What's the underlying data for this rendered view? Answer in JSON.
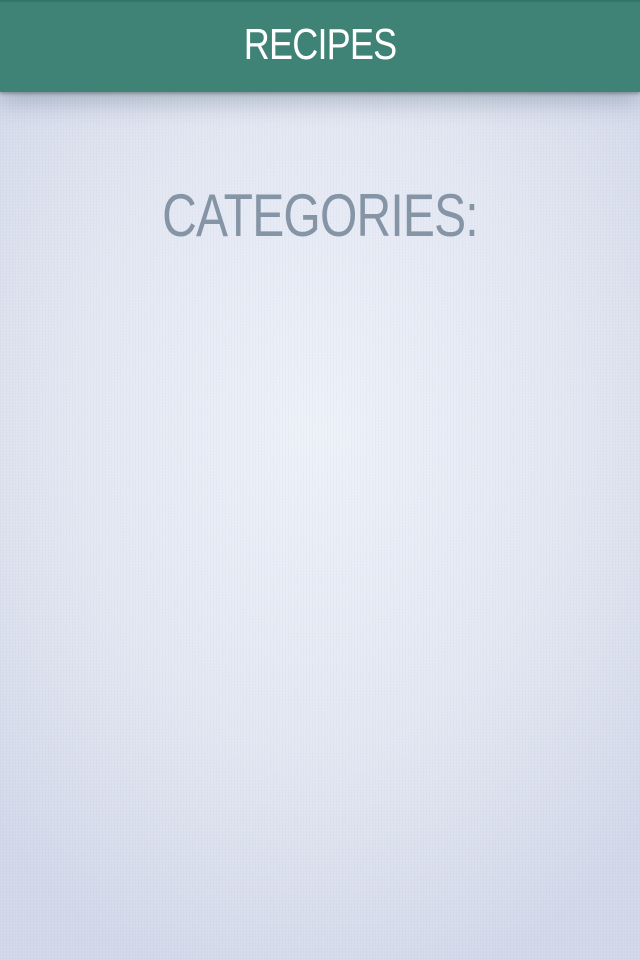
{
  "header": {
    "title": "RECIPES"
  },
  "main": {
    "section_title": "CATEGORIES:",
    "categories": []
  },
  "colors": {
    "header_bg": "#3f8276",
    "header_text": "#ffffff",
    "section_title": "#8595a6",
    "background": "#e3e7f2"
  }
}
